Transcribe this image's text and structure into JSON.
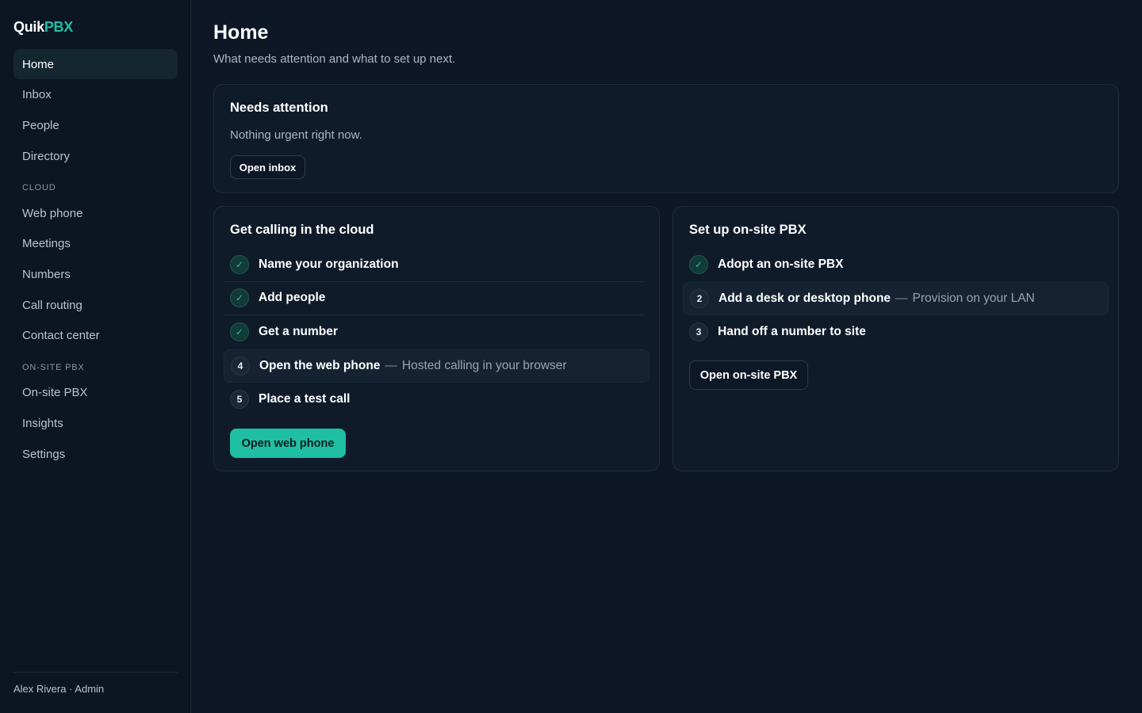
{
  "app": {
    "logo_part1": "Quik",
    "logo_part2": "PBX"
  },
  "sidebar": {
    "items": [
      {
        "label": "Home",
        "active": true
      },
      {
        "label": "Inbox"
      },
      {
        "label": "People"
      },
      {
        "label": "Directory"
      }
    ],
    "section_cloud": "CLOUD",
    "cloud_items": [
      {
        "label": "Web phone"
      },
      {
        "label": "Meetings"
      },
      {
        "label": "Numbers"
      },
      {
        "label": "Call routing"
      },
      {
        "label": "Contact center"
      }
    ],
    "section_onsite": "ON-SITE PBX",
    "onsite_items": [
      {
        "label": "On-site PBX"
      },
      {
        "label": "Insights"
      },
      {
        "label": "Settings"
      }
    ],
    "user": "Alex Rivera · Admin"
  },
  "main": {
    "title": "Home",
    "subtitle": "What needs attention and what to set up next.",
    "attention": {
      "title": "Needs attention",
      "text": "Nothing urgent right now.",
      "button": "Open inbox"
    },
    "cloud": {
      "title": "Get calling in the cloud",
      "steps": [
        {
          "label": "Name your organization",
          "status": "done"
        },
        {
          "label": "Add people",
          "status": "done"
        },
        {
          "label": "Get a number",
          "status": "done"
        },
        {
          "number": "4",
          "label": "Open the web phone",
          "separator": "—",
          "desc": "Hosted calling in your browser",
          "status": "current"
        },
        {
          "number": "5",
          "label": "Place a test call",
          "status": "todo"
        }
      ],
      "button": "Open web phone"
    },
    "onsite": {
      "title": "Set up on-site PBX",
      "steps": [
        {
          "label": "Adopt an on-site PBX",
          "status": "done"
        },
        {
          "number": "2",
          "label": "Add a desk or desktop phone",
          "separator": "—",
          "desc": "Provision on your LAN",
          "status": "current"
        },
        {
          "number": "3",
          "label": "Hand off a number to site",
          "status": "todo"
        }
      ],
      "button": "Open on-site PBX"
    }
  },
  "icons": {
    "check": "check-icon"
  },
  "colors": {
    "accent": "#1fbfa4",
    "background": "#0e1726",
    "card": "#101b2a"
  }
}
